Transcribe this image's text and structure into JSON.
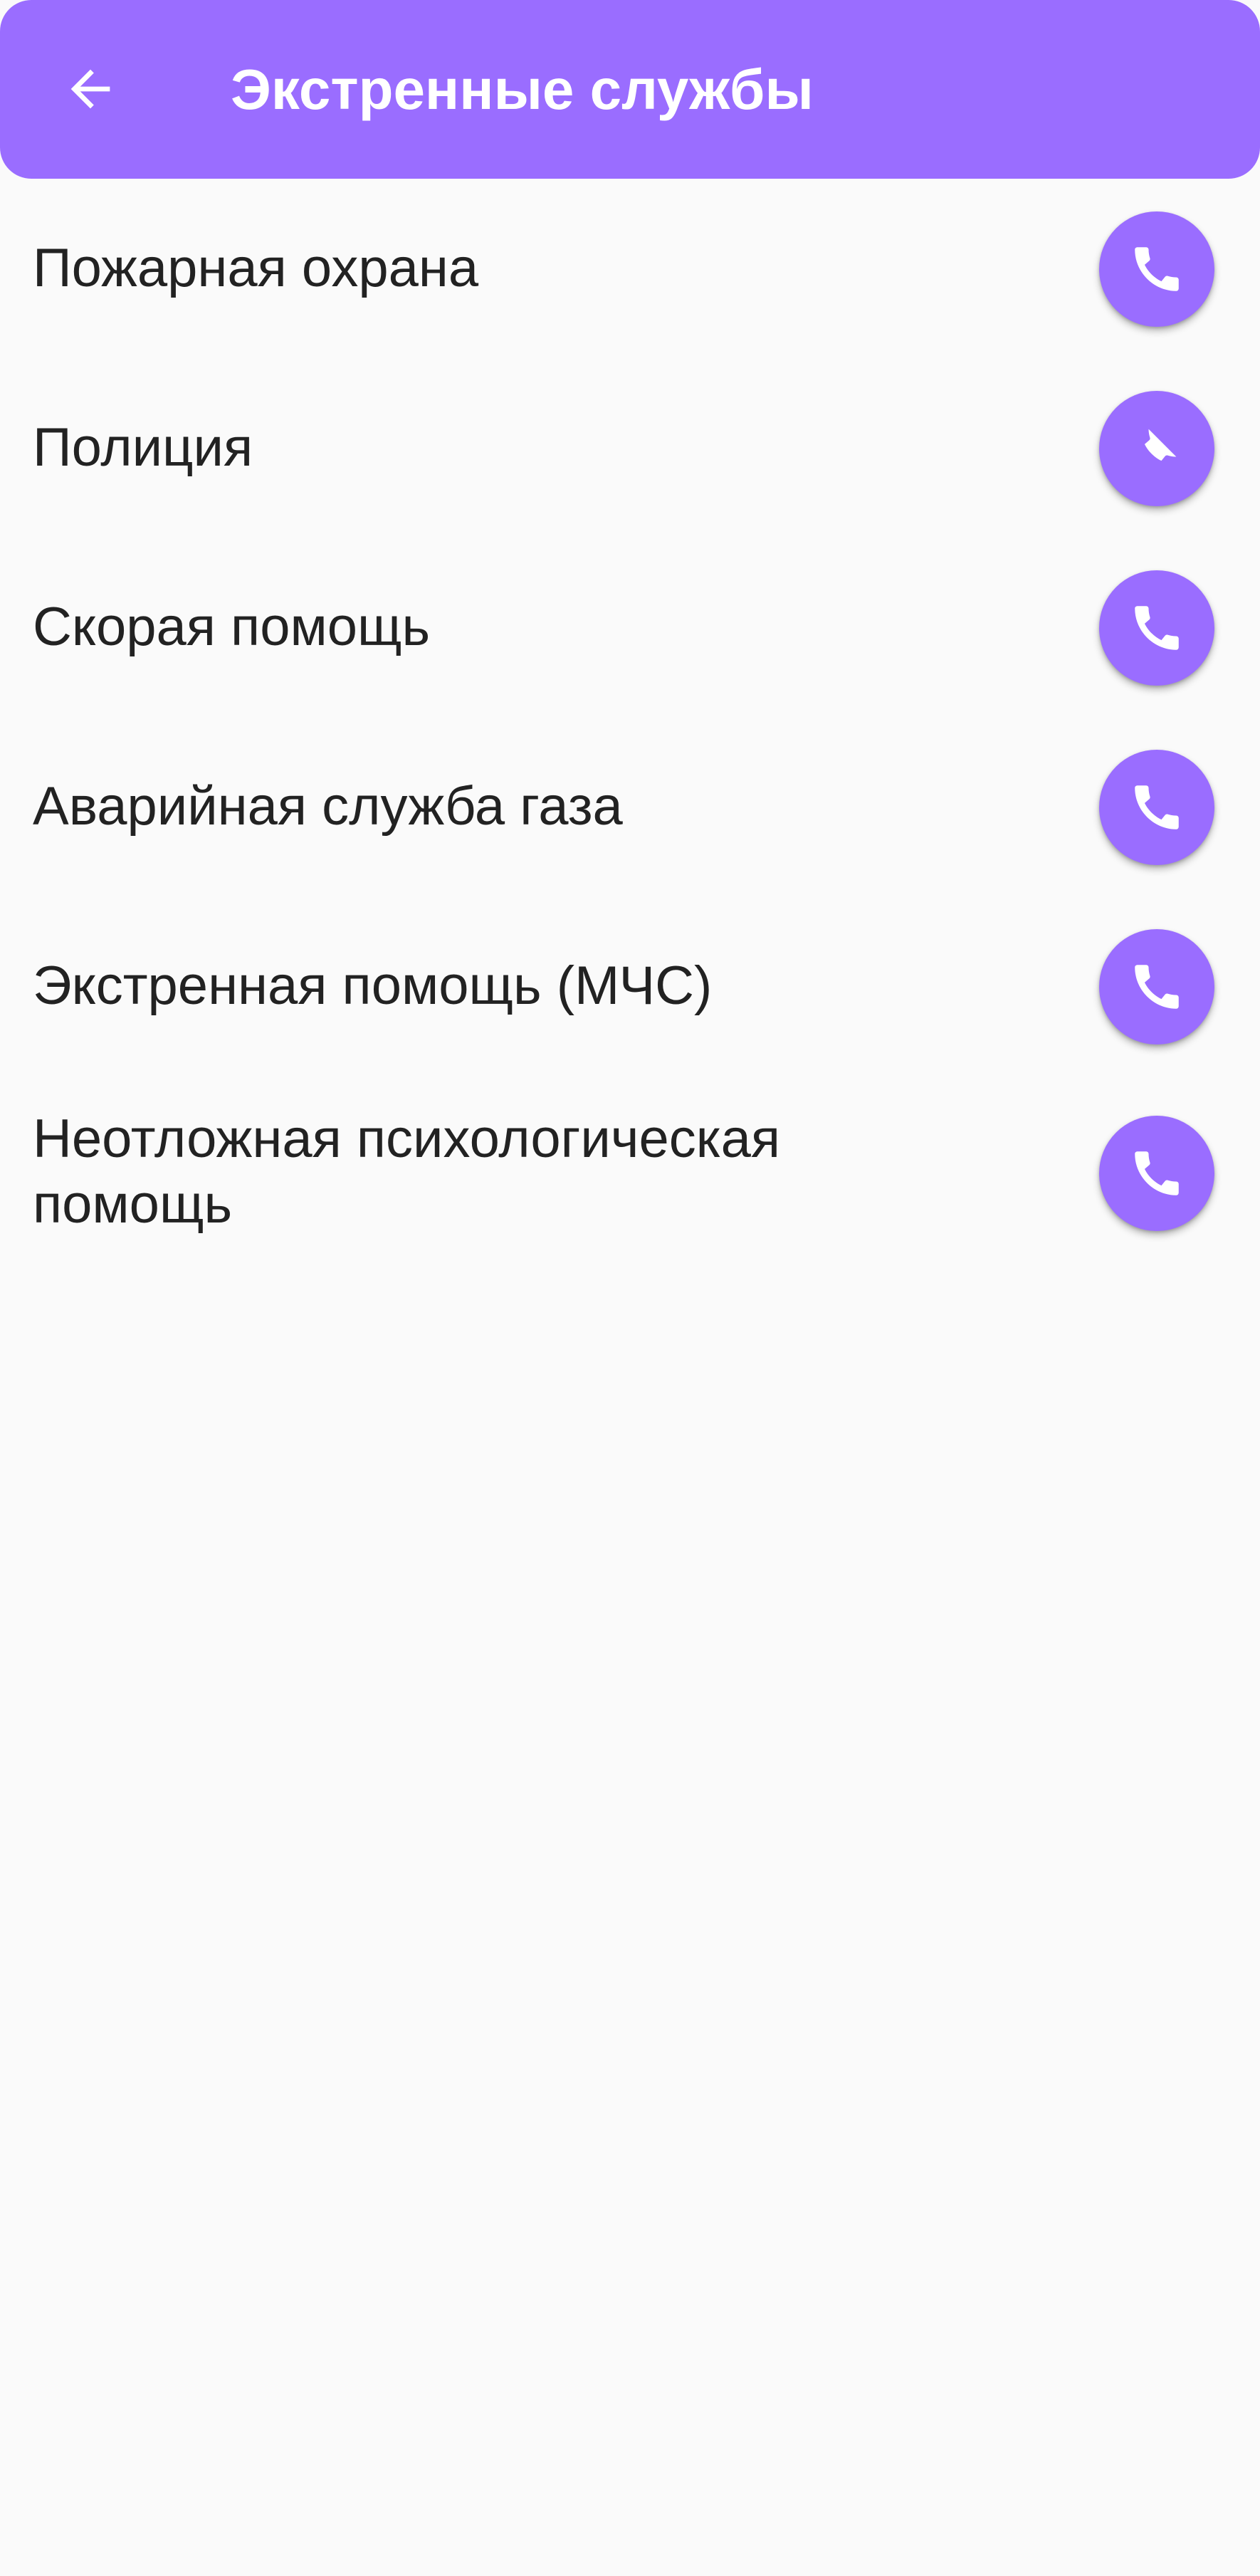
{
  "header": {
    "title": "Экстренные службы",
    "back_icon": "arrow-left-icon",
    "background_color": "#9a6dff",
    "text_color": "#ffffff"
  },
  "services": [
    {
      "label": "Пожарная охрана",
      "action_icon": "phone-icon"
    },
    {
      "label": "Полиция",
      "action_icon": "phone-icon"
    },
    {
      "label": "Скорая помощь",
      "action_icon": "phone-icon"
    },
    {
      "label": "Аварийная служба газа",
      "action_icon": "phone-icon"
    },
    {
      "label": "Экстренная помощь (МЧС)",
      "action_icon": "phone-icon"
    },
    {
      "label": "Неотложная психологическая помощь",
      "action_icon": "phone-icon"
    }
  ],
  "colors": {
    "accent": "#9a6dff",
    "background": "#fafafa",
    "text": "#222222"
  }
}
